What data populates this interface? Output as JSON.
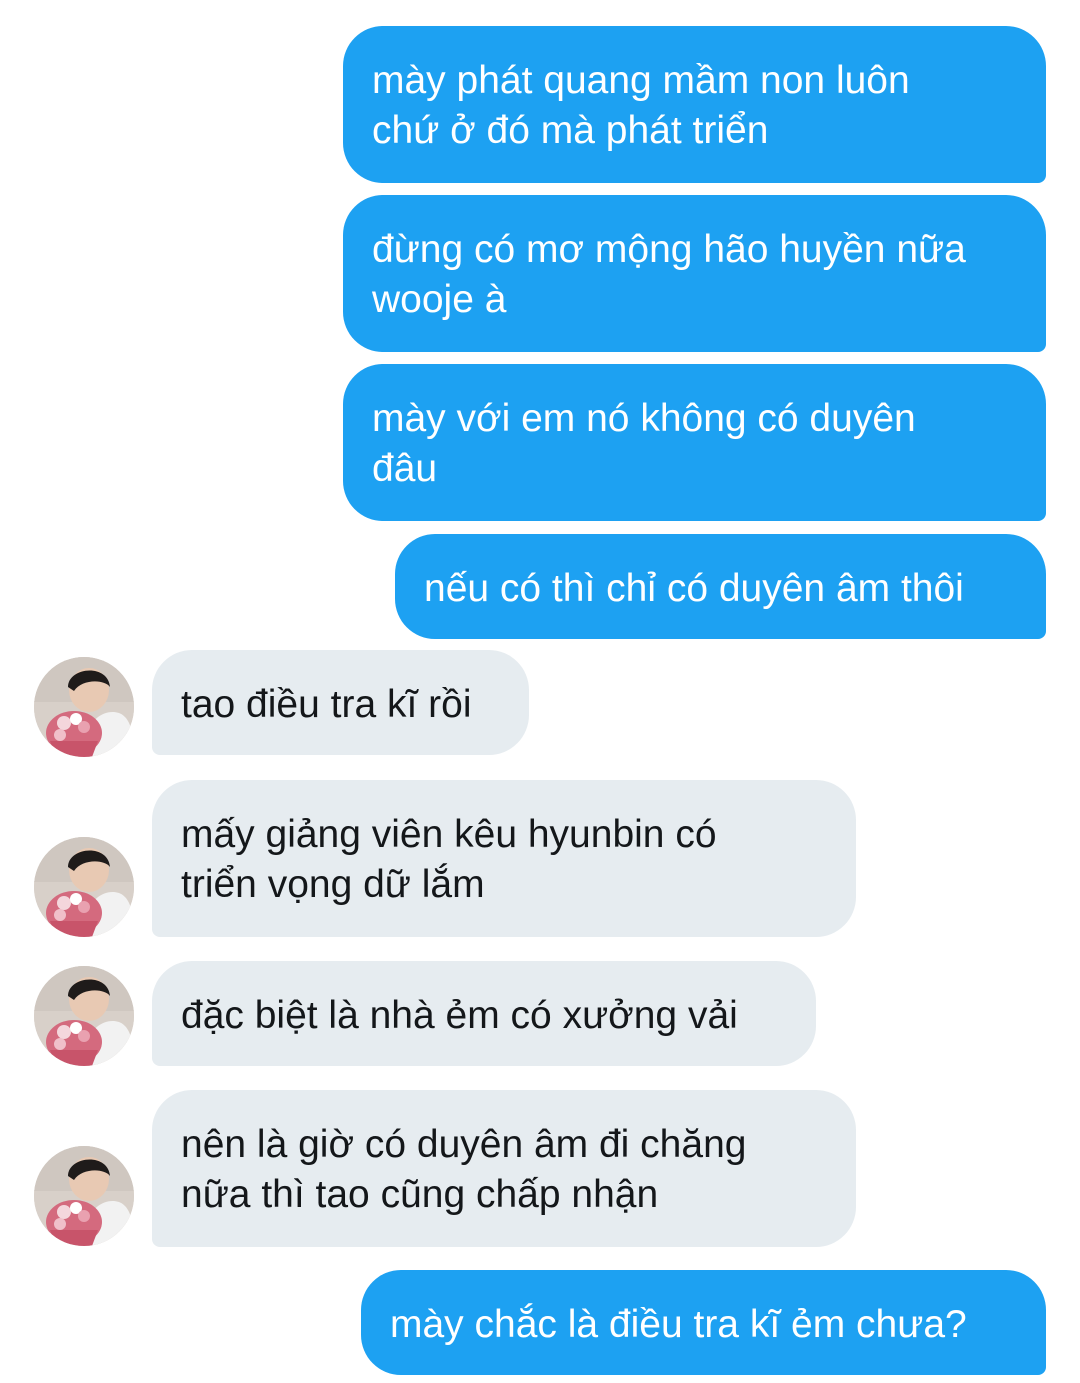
{
  "messages": [
    {
      "side": "out",
      "text": "mày phát quang mầm non luôn\nchứ ở đó mà phát triển"
    },
    {
      "side": "out",
      "text": "đừng có mơ mộng hão huyền nữa\nwooje à"
    },
    {
      "side": "out",
      "text": "mày với em nó không có duyên\nđâu"
    },
    {
      "side": "out",
      "text": "nếu có thì chỉ có duyên âm thôi"
    },
    {
      "side": "in",
      "text": "tao điều tra kĩ rồi"
    },
    {
      "side": "in",
      "text": "mấy giảng viên kêu hyunbin có\ntriển vọng dữ lắm"
    },
    {
      "side": "in",
      "text": "đặc biệt là nhà ẻm có xưởng vải"
    },
    {
      "side": "in",
      "text": "nên là giờ có duyên âm đi chăng\nnữa thì tao cũng chấp nhận"
    },
    {
      "side": "out",
      "text": "mày chắc là điều tra kĩ ẻm chưa?"
    }
  ],
  "colors": {
    "outgoing_bubble": "#1da1f2",
    "incoming_bubble": "#e6ecf0",
    "outgoing_text": "#ffffff",
    "incoming_text": "#14171a"
  },
  "avatar": {
    "icon": "profile-photo-avatar"
  }
}
